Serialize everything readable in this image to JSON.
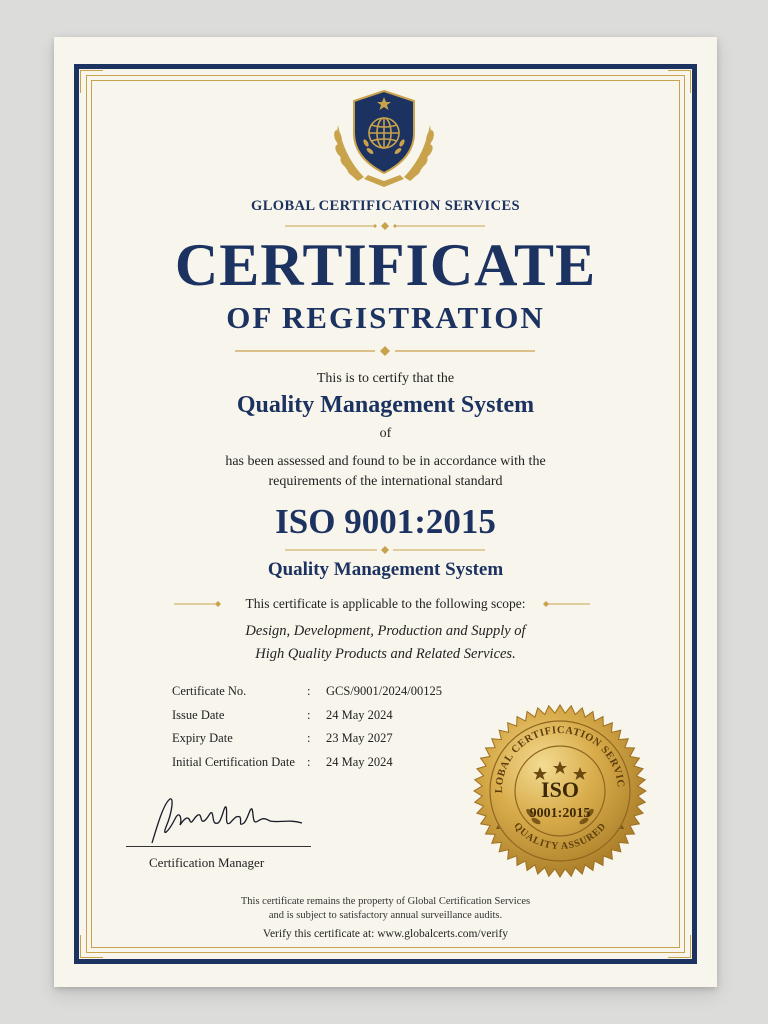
{
  "certificate": {
    "organization": "GLOBAL CERTIFICATION SERVICES",
    "title": "CERTIFICATE",
    "subtitle": "OF REGISTRATION",
    "certify_line": "This is to certify that the",
    "system_name": "Quality Management System",
    "of_word": "of",
    "assessed_line1": "has been assessed and found to be in accordance with the",
    "assessed_line2": "requirements of the international standard",
    "standard": "ISO 9001:2015",
    "standard_name": "Quality Management System",
    "scope_intro": "This certificate is applicable to the following scope:",
    "scope_line1": "Design, Development, Production and Supply of",
    "scope_line2": "High Quality Products and Related Services.",
    "details": [
      {
        "label": "Certificate No.",
        "value": "GCS/9001/2024/00125"
      },
      {
        "label": "Issue Date",
        "value": "24 May 2024"
      },
      {
        "label": "Expiry Date",
        "value": "23 May 2027"
      },
      {
        "label": "Initial Certification Date",
        "value": "24 May 2024"
      }
    ],
    "detail_separator": ":",
    "signatory_title": "Certification Manager",
    "footer_line1": "This certificate remains the property of Global Certification Services",
    "footer_line2": "and is subject to satisfactory annual surveillance audits.",
    "verify_line": "Verify this certificate at: www.globalcerts.com/verify"
  },
  "seal": {
    "ring_text": "GLOBAL CERTIFICATION SERVICES",
    "bottom_text": "QUALITY ASSURED",
    "center_big": "ISO",
    "center_small": "9001:2015"
  },
  "colors": {
    "navy": "#1c3260",
    "gold": "#c9a24c",
    "paper": "#f8f5ec"
  },
  "icons": [
    "shield-globe-emblem-icon",
    "laurel-wreath-icon",
    "star-icon",
    "diamond-ornament-icon",
    "gold-seal-icon",
    "signature"
  ]
}
